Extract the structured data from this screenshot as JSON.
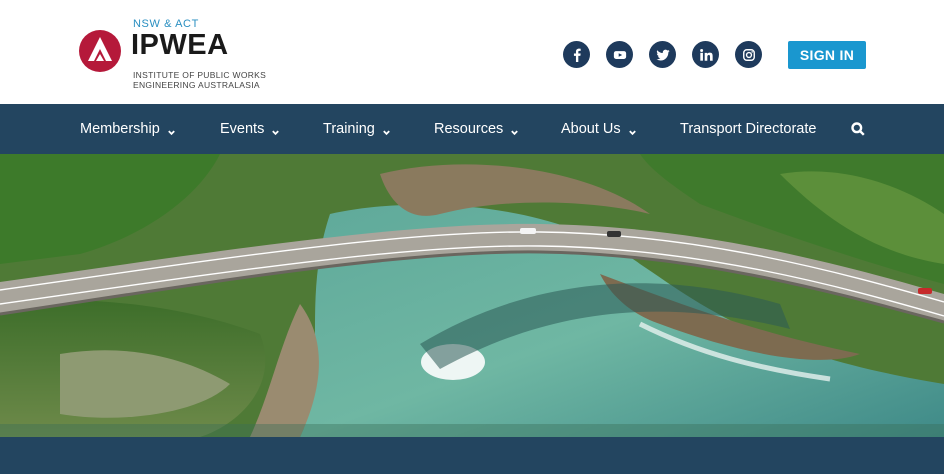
{
  "logo": {
    "region": "NSW & ACT",
    "name": "IPWEA",
    "subtitle_line1": "INSTITUTE OF PUBLIC WORKS",
    "subtitle_line2": "ENGINEERING AUSTRALASIA",
    "brand_color": "#b5193a"
  },
  "social": [
    {
      "name": "facebook-icon"
    },
    {
      "name": "youtube-icon"
    },
    {
      "name": "twitter-icon"
    },
    {
      "name": "linkedin-icon"
    },
    {
      "name": "instagram-icon"
    }
  ],
  "header": {
    "signin_label": "SIGN IN",
    "signin_color": "#1a97cf"
  },
  "nav": {
    "background": "#234560",
    "items": [
      {
        "label": "Membership",
        "has_dropdown": true
      },
      {
        "label": "Events",
        "has_dropdown": true
      },
      {
        "label": "Training",
        "has_dropdown": true
      },
      {
        "label": "Resources",
        "has_dropdown": true
      },
      {
        "label": "About Us",
        "has_dropdown": true
      },
      {
        "label": "Transport Directorate",
        "has_dropdown": false
      }
    ]
  }
}
